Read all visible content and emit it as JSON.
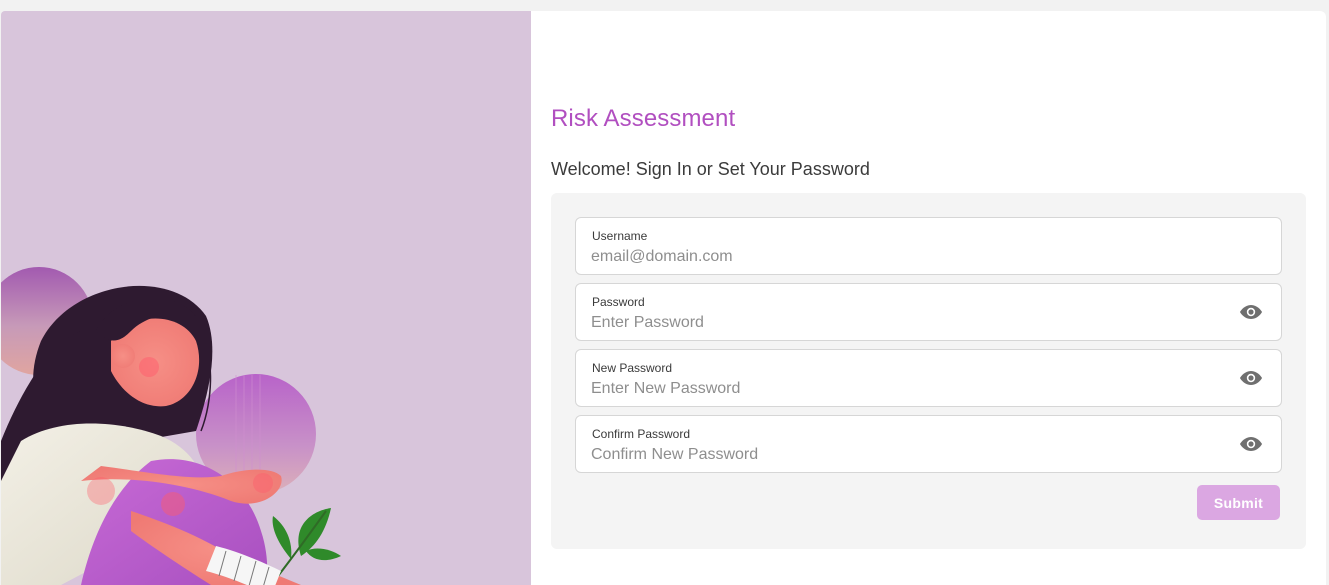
{
  "app": {
    "title": "Risk Assessment",
    "welcome": "Welcome! Sign In or Set Your Password"
  },
  "form": {
    "fields": [
      {
        "label": "Username",
        "placeholder": "email@domain.com",
        "type": "text",
        "has_visibility_toggle": false
      },
      {
        "label": "Password",
        "placeholder": "Enter Password",
        "type": "password",
        "has_visibility_toggle": true,
        "toggle_icon": "eye-icon"
      },
      {
        "label": "New Password",
        "placeholder": "Enter New Password",
        "type": "password",
        "has_visibility_toggle": true,
        "toggle_icon": "eye-icon"
      },
      {
        "label": "Confirm Password",
        "placeholder": "Confirm New Password",
        "type": "password",
        "has_visibility_toggle": true,
        "toggle_icon": "eye-icon"
      }
    ],
    "submit_label": "Submit"
  },
  "colors": {
    "accent": "#b14fc0",
    "submit_disabled": "#dba7e2",
    "illustration_bg": "#d8c5db",
    "card_bg": "#f4f4f4"
  }
}
